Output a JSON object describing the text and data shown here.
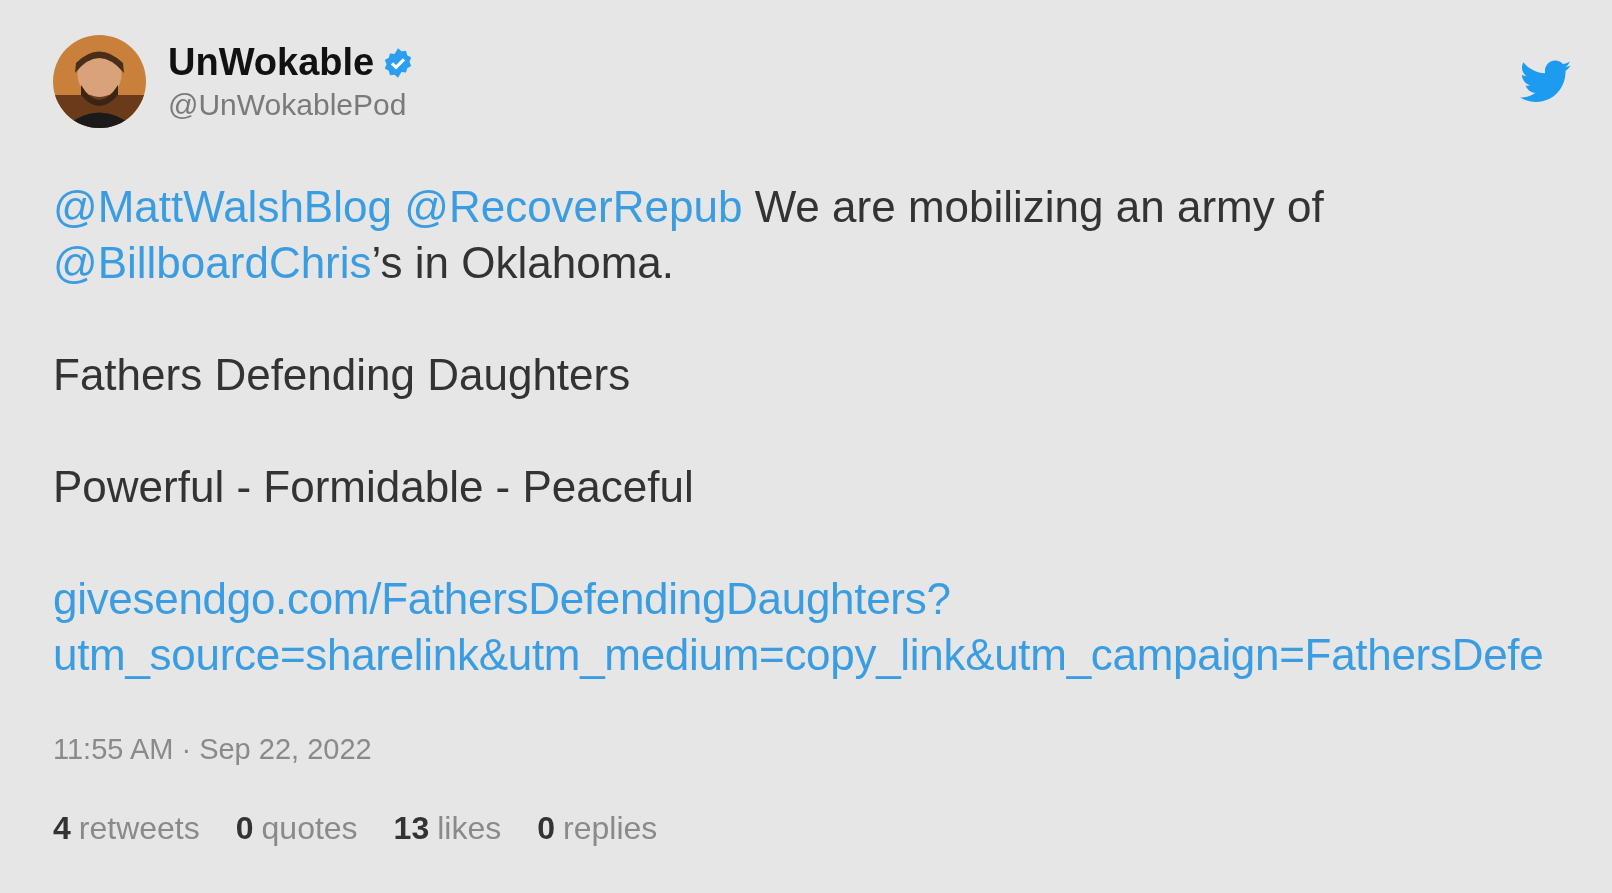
{
  "author": {
    "name": "UnWokable",
    "verified": true,
    "handle": "@UnWokablePod"
  },
  "tweet": {
    "paragraphs": [
      {
        "lines": [
          [
            {
              "kind": "mention",
              "text": "@MattWalshBlog"
            },
            {
              "kind": "mention",
              "text": "@RecoverRepub"
            },
            {
              "kind": "text",
              "text": " We are mobilizing an army of"
            }
          ],
          [
            {
              "kind": "mention",
              "text": "@BillboardChris"
            },
            {
              "kind": "text",
              "text": "’s in Oklahoma."
            }
          ]
        ]
      },
      {
        "lines": [
          [
            {
              "kind": "text",
              "text": "Fathers Defending Daughters"
            }
          ]
        ]
      },
      {
        "lines": [
          [
            {
              "kind": "text",
              "text": "Powerful - Formidable - Peaceful"
            }
          ]
        ]
      },
      {
        "lines": [
          [
            {
              "kind": "link",
              "text": "givesendgo.com/FathersDefendingDaughters?"
            }
          ],
          [
            {
              "kind": "link",
              "text": "utm_source=sharelink&utm_medium=copy_link&utm_campaign=FathersDefe"
            }
          ]
        ]
      }
    ]
  },
  "timestamp": "11:55 AM · Sep 22, 2022",
  "stats": [
    {
      "count": "4",
      "label": "retweets"
    },
    {
      "count": "0",
      "label": "quotes"
    },
    {
      "count": "13",
      "label": "likes"
    },
    {
      "count": "0",
      "label": "replies"
    }
  ]
}
